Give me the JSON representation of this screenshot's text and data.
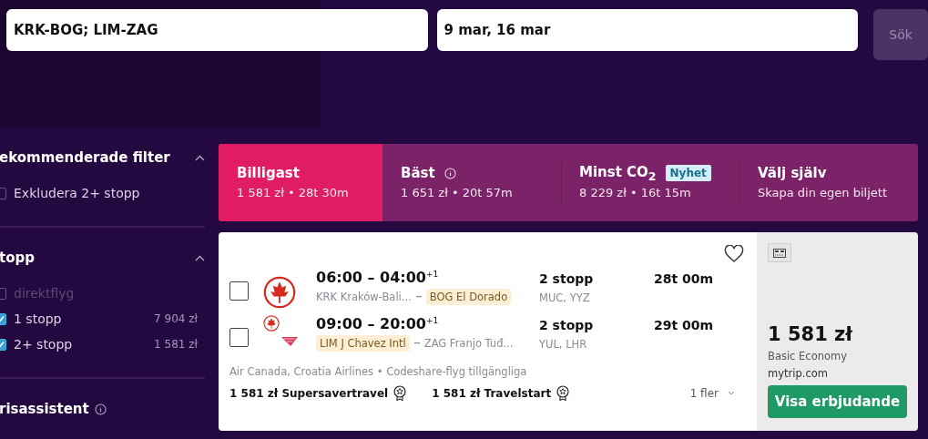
{
  "search": {
    "route": "KRK-BOG; LIM-ZAG",
    "dates": "9 mar, 16 mar",
    "button": "Sök"
  },
  "filters": [
    {
      "title": "ekommenderade filter",
      "expanded": true,
      "info": false,
      "items": [
        {
          "label": "Exkludera 2+ stopp",
          "checked": false,
          "disabled": false
        }
      ]
    },
    {
      "title": "topp",
      "expanded": true,
      "info": false,
      "items": [
        {
          "label": "direktflyg",
          "checked": false,
          "disabled": true
        },
        {
          "label": "1 stopp",
          "checked": true,
          "disabled": false,
          "price": "7 904 zł"
        },
        {
          "label": "2+ stopp",
          "checked": true,
          "disabled": false,
          "price": "1 581 zł"
        }
      ]
    },
    {
      "title": "risassistent",
      "info": true
    }
  ],
  "tabs": [
    {
      "title": "Billigast",
      "subtitle": "1 581 zł • 28t 30m",
      "selected": true,
      "info": false
    },
    {
      "title": "Bäst",
      "subtitle": "1 651 zł • 20t 57m",
      "selected": false,
      "info": true
    },
    {
      "title": "Minst CO$_{2}$",
      "subtitle": "8 229 zł • 16t 15m",
      "selected": false,
      "info": false,
      "badge": "Nyhet"
    },
    {
      "title": "Välj själv",
      "subtitle": "Skapa din egen biljett",
      "selected": false,
      "info": false
    }
  ],
  "result": {
    "favorite": false,
    "legs": [
      {
        "checked": false,
        "kind": "single",
        "times": "06:00 – 04:00",
        "day_offset": "+1",
        "origin": {
          "text": "KRK Kraków-Bali...",
          "highlighted": false
        },
        "destination": {
          "text": "BOG El Dorado",
          "highlighted": true
        },
        "stops": "2 stopp",
        "via": "MUC, YYZ",
        "duration": "28t 00m"
      },
      {
        "checked": false,
        "kind": "double",
        "times": "09:00 – 20:00",
        "day_offset": "+1",
        "origin": {
          "text": "LIM J Chavez Intl",
          "highlighted": true
        },
        "destination": {
          "text": "ZAG Franjo Tuđ...",
          "highlighted": false
        },
        "stops": "2 stopp",
        "via": "YUL, LHR",
        "duration": "29t 00m"
      }
    ],
    "airlines": "Air Canada, Croatia Airlines • Codeshare-flyg tillgängliga",
    "providers": [
      {
        "price": "1 581 zł",
        "name": "Supersavertravel"
      },
      {
        "price": "1 581 zł",
        "name": "Travelstart"
      }
    ],
    "more": "1 fler",
    "price": "1 581 zł",
    "fare": "Basic Economy",
    "seller": "mytrip.com",
    "cta": "Visa erbjudande"
  }
}
